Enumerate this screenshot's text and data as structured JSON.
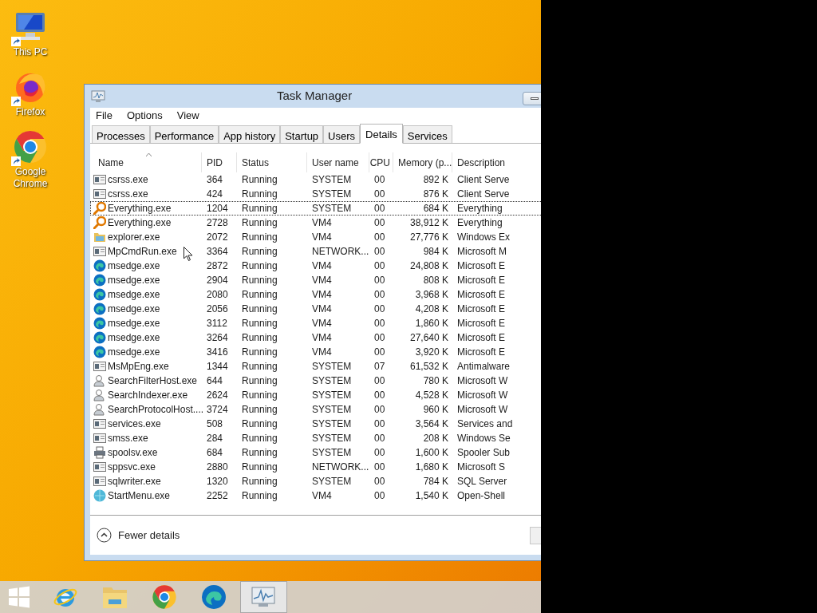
{
  "desktop_icons": [
    {
      "kind": "pc",
      "label": "This PC"
    },
    {
      "kind": "firefox",
      "label": "Firefox"
    },
    {
      "kind": "chrome",
      "label": "Google Chrome"
    }
  ],
  "window": {
    "title": "Task Manager",
    "menu": [
      "File",
      "Options",
      "View"
    ],
    "tabs": [
      {
        "label": "Processes",
        "selected": false
      },
      {
        "label": "Performance",
        "selected": false
      },
      {
        "label": "App history",
        "selected": false
      },
      {
        "label": "Startup",
        "selected": false
      },
      {
        "label": "Users",
        "selected": false
      },
      {
        "label": "Details",
        "selected": true
      },
      {
        "label": "Services",
        "selected": false
      }
    ],
    "columns": [
      {
        "label": "Name",
        "sorted": true
      },
      {
        "label": "PID",
        "sorted": false
      },
      {
        "label": "Status",
        "sorted": false
      },
      {
        "label": "User name",
        "sorted": false
      },
      {
        "label": "CPU",
        "sorted": false
      },
      {
        "label": "Memory (p...",
        "sorted": false
      },
      {
        "label": "Description",
        "sorted": false
      }
    ],
    "rows": [
      {
        "kind": "app",
        "name": "csrss.exe",
        "pid": "364",
        "status": "Running",
        "user": "SYSTEM",
        "cpu": "00",
        "memory": "892 K",
        "description": "Client Serve",
        "selected": false
      },
      {
        "kind": "app",
        "name": "csrss.exe",
        "pid": "424",
        "status": "Running",
        "user": "SYSTEM",
        "cpu": "00",
        "memory": "876 K",
        "description": "Client Serve",
        "selected": false
      },
      {
        "kind": "magnifier",
        "name": "Everything.exe",
        "pid": "1204",
        "status": "Running",
        "user": "SYSTEM",
        "cpu": "00",
        "memory": "684 K",
        "description": "Everything",
        "selected": true
      },
      {
        "kind": "magnifier",
        "name": "Everything.exe",
        "pid": "2728",
        "status": "Running",
        "user": "VM4",
        "cpu": "00",
        "memory": "38,912 K",
        "description": "Everything",
        "selected": false
      },
      {
        "kind": "folder",
        "name": "explorer.exe",
        "pid": "2072",
        "status": "Running",
        "user": "VM4",
        "cpu": "00",
        "memory": "27,776 K",
        "description": "Windows Ex",
        "selected": false
      },
      {
        "kind": "app",
        "name": "MpCmdRun.exe",
        "pid": "3364",
        "status": "Running",
        "user": "NETWORK...",
        "cpu": "00",
        "memory": "984 K",
        "description": "Microsoft M",
        "selected": false
      },
      {
        "kind": "edge",
        "name": "msedge.exe",
        "pid": "2872",
        "status": "Running",
        "user": "VM4",
        "cpu": "00",
        "memory": "24,808 K",
        "description": "Microsoft E",
        "selected": false
      },
      {
        "kind": "edge",
        "name": "msedge.exe",
        "pid": "2904",
        "status": "Running",
        "user": "VM4",
        "cpu": "00",
        "memory": "808 K",
        "description": "Microsoft E",
        "selected": false
      },
      {
        "kind": "edge",
        "name": "msedge.exe",
        "pid": "2080",
        "status": "Running",
        "user": "VM4",
        "cpu": "00",
        "memory": "3,968 K",
        "description": "Microsoft E",
        "selected": false
      },
      {
        "kind": "edge",
        "name": "msedge.exe",
        "pid": "2056",
        "status": "Running",
        "user": "VM4",
        "cpu": "00",
        "memory": "4,208 K",
        "description": "Microsoft E",
        "selected": false
      },
      {
        "kind": "edge",
        "name": "msedge.exe",
        "pid": "3112",
        "status": "Running",
        "user": "VM4",
        "cpu": "00",
        "memory": "1,860 K",
        "description": "Microsoft E",
        "selected": false
      },
      {
        "kind": "edge",
        "name": "msedge.exe",
        "pid": "3264",
        "status": "Running",
        "user": "VM4",
        "cpu": "00",
        "memory": "27,640 K",
        "description": "Microsoft E",
        "selected": false
      },
      {
        "kind": "edge",
        "name": "msedge.exe",
        "pid": "3416",
        "status": "Running",
        "user": "VM4",
        "cpu": "00",
        "memory": "3,920 K",
        "description": "Microsoft E",
        "selected": false
      },
      {
        "kind": "app",
        "name": "MsMpEng.exe",
        "pid": "1344",
        "status": "Running",
        "user": "SYSTEM",
        "cpu": "07",
        "memory": "61,532 K",
        "description": "Antimalware",
        "selected": false
      },
      {
        "kind": "search",
        "name": "SearchFilterHost.exe",
        "pid": "644",
        "status": "Running",
        "user": "SYSTEM",
        "cpu": "00",
        "memory": "780 K",
        "description": "Microsoft W",
        "selected": false
      },
      {
        "kind": "search",
        "name": "SearchIndexer.exe",
        "pid": "2624",
        "status": "Running",
        "user": "SYSTEM",
        "cpu": "00",
        "memory": "4,528 K",
        "description": "Microsoft W",
        "selected": false
      },
      {
        "kind": "search",
        "name": "SearchProtocolHost....",
        "pid": "3724",
        "status": "Running",
        "user": "SYSTEM",
        "cpu": "00",
        "memory": "960 K",
        "description": "Microsoft W",
        "selected": false
      },
      {
        "kind": "app",
        "name": "services.exe",
        "pid": "508",
        "status": "Running",
        "user": "SYSTEM",
        "cpu": "00",
        "memory": "3,564 K",
        "description": "Services and",
        "selected": false
      },
      {
        "kind": "app",
        "name": "smss.exe",
        "pid": "284",
        "status": "Running",
        "user": "SYSTEM",
        "cpu": "00",
        "memory": "208 K",
        "description": "Windows Se",
        "selected": false
      },
      {
        "kind": "printer",
        "name": "spoolsv.exe",
        "pid": "684",
        "status": "Running",
        "user": "SYSTEM",
        "cpu": "00",
        "memory": "1,600 K",
        "description": "Spooler Sub",
        "selected": false
      },
      {
        "kind": "app",
        "name": "sppsvc.exe",
        "pid": "2880",
        "status": "Running",
        "user": "NETWORK...",
        "cpu": "00",
        "memory": "1,680 K",
        "description": "Microsoft S",
        "selected": false
      },
      {
        "kind": "app",
        "name": "sqlwriter.exe",
        "pid": "1320",
        "status": "Running",
        "user": "SYSTEM",
        "cpu": "00",
        "memory": "784 K",
        "description": "SQL Server",
        "selected": false
      },
      {
        "kind": "globe",
        "name": "StartMenu.exe",
        "pid": "2252",
        "status": "Running",
        "user": "VM4",
        "cpu": "00",
        "memory": "1,540 K",
        "description": "Open-Shell",
        "selected": false
      }
    ],
    "footer_button": "Fewer details"
  },
  "taskbar": [
    {
      "kind": "start",
      "active": false
    },
    {
      "kind": "ie",
      "active": false
    },
    {
      "kind": "folder",
      "active": false
    },
    {
      "kind": "chrome",
      "active": false
    },
    {
      "kind": "edge",
      "active": false
    },
    {
      "kind": "taskmanager",
      "active": true
    }
  ]
}
